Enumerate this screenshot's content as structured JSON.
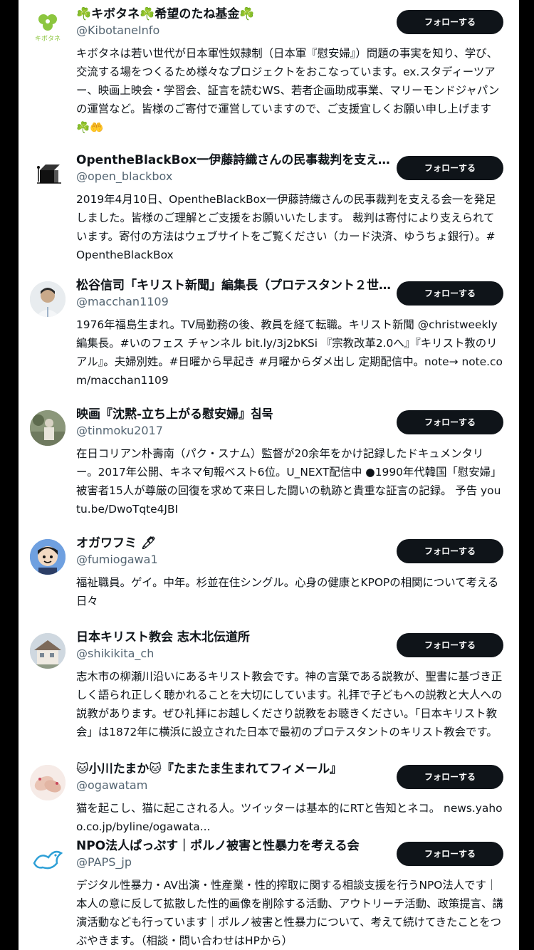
{
  "accounts": [
    {
      "name": "☘️キボタネ☘️希望のたね基金☘️",
      "handle": "@KibotaneInfo",
      "follow_label": "フォローする",
      "bio": "キボタネは若い世代が日本軍性奴隷制（日本軍『慰安婦』）問題の事実を知り、学び、交流する場をつくるため様々なプロジェクトをおこなっています。ex.スタディーツアー、映画上映会・学習会、証言を読むWS、若者企画助成事業、マリーモンドジャパンの運営など。皆様のご寄付で運営していますので、ご支援宜しくお願い申し上げます☘️🤲",
      "avatar_text": "キボタネ"
    },
    {
      "name": "OpentheBlackBox一伊藤詩織さんの民事裁判を支える…",
      "handle": "@open_blackbox",
      "follow_label": "フォローする",
      "bio": "2019年4月10日、OpentheBlackBox一伊藤詩織さんの民事裁判を支える会一を発足しました。皆様のご理解とご支援をお願いいたします。 裁判は寄付により支えられています。寄付の方法はウェブサイトをご覧ください（カード決済、ゆうちょ銀行）。#OpentheBlackBox"
    },
    {
      "name": "松谷信司「キリスト新聞」編集長（プロテスタント２世…",
      "handle": "@macchan1109",
      "follow_label": "フォローする",
      "bio": "1976年福島生まれ。TV局勤務の後、教員を経て転職。キリスト新聞 @christweekly 編集長。#いのフェス チャンネル bit.ly/3j2bKSi 『宗教改革2.0へ』『キリスト教のリアル』。夫婦別姓。#日曜から早起き #月曜からダメ出し 定期配信中。note→ note.com/macchan1109"
    },
    {
      "name": "映画『沈黙-立ち上がる慰安婦』침묵",
      "handle": "@tinmoku2017",
      "follow_label": "フォローする",
      "bio": "在日コリアン朴壽南（パク・スナム）監督が20余年をかけ記録したドキュメンタリー。2017年公開、キネマ旬報ベスト6位。U_NEXT配信中 ●1990年代韓国「慰安婦」被害者15人が尊厳の回復を求めて来日した闘いの軌跡と貴重な証言の記録。 予告 youtu.be/DwoTqte4JBI"
    },
    {
      "name": "オガワフミ 🖊",
      "handle": "@fumiogawa1",
      "follow_label": "フォローする",
      "bio": "福祉職員。ゲイ。中年。杉並在住シングル。心身の健康とKPOPの相関について考える日々"
    },
    {
      "name": "日本キリスト教会 志木北伝道所",
      "handle": "@shikikita_ch",
      "follow_label": "フォローする",
      "bio": "志木市の柳瀬川沿いにあるキリスト教会です。神の言葉である説教が、聖書に基づき正しく語られ正しく聴かれることを大切にしています。礼拝で子どもへの説教と大人への説教があります。ぜひ礼拝にお越しくださり説教をお聴きください。「日本キリスト教会」は1872年に横浜に設立された日本で最初のプロテスタントのキリスト教会です。"
    },
    {
      "name": "🐱小川たまか🐱『たまたま生まれてフィメール』",
      "handle": "@ogawatam",
      "follow_label": "フォローする",
      "bio": "猫を起こし、猫に起こされる人。ツイッターは基本的にRTと告知とネコ。 news.yahoo.co.jp/byline/ogawata..."
    },
    {
      "name": "NPO法人ぱっぷす｜ポルノ被害と性暴力を考える会",
      "handle": "@PAPS_jp",
      "follow_label": "フォローする",
      "bio": "デジタル性暴力・AV出演・性産業・性的搾取に関する相談支援を行うNPO法人です｜本人の意に反して拡散した性的画像を削除する活動、アウトリーチ活動、政策提言、講演活動なども行っています｜ポルノ被害と性暴力について、考えて続けてきたことをつぶやきます。（相談・問い合わせはHPから）"
    }
  ]
}
